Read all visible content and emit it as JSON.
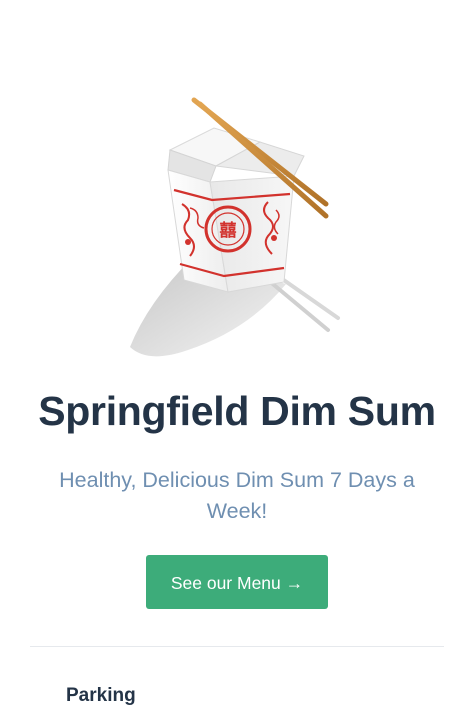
{
  "hero": {
    "image_subject": "takeout-box-with-chopsticks",
    "colors": {
      "box": "#f4f4f4",
      "print_red": "#d2322d",
      "chopsticks": "#c9873a",
      "shadow": "#cfcfcf"
    }
  },
  "title": "Springfield Dim Sum",
  "subtitle": "Healthy, Delicious Dim Sum 7 Days a Week!",
  "cta": {
    "label": "See our Menu →",
    "color": "#3dac7a"
  },
  "next_section": {
    "label": "Parking"
  }
}
